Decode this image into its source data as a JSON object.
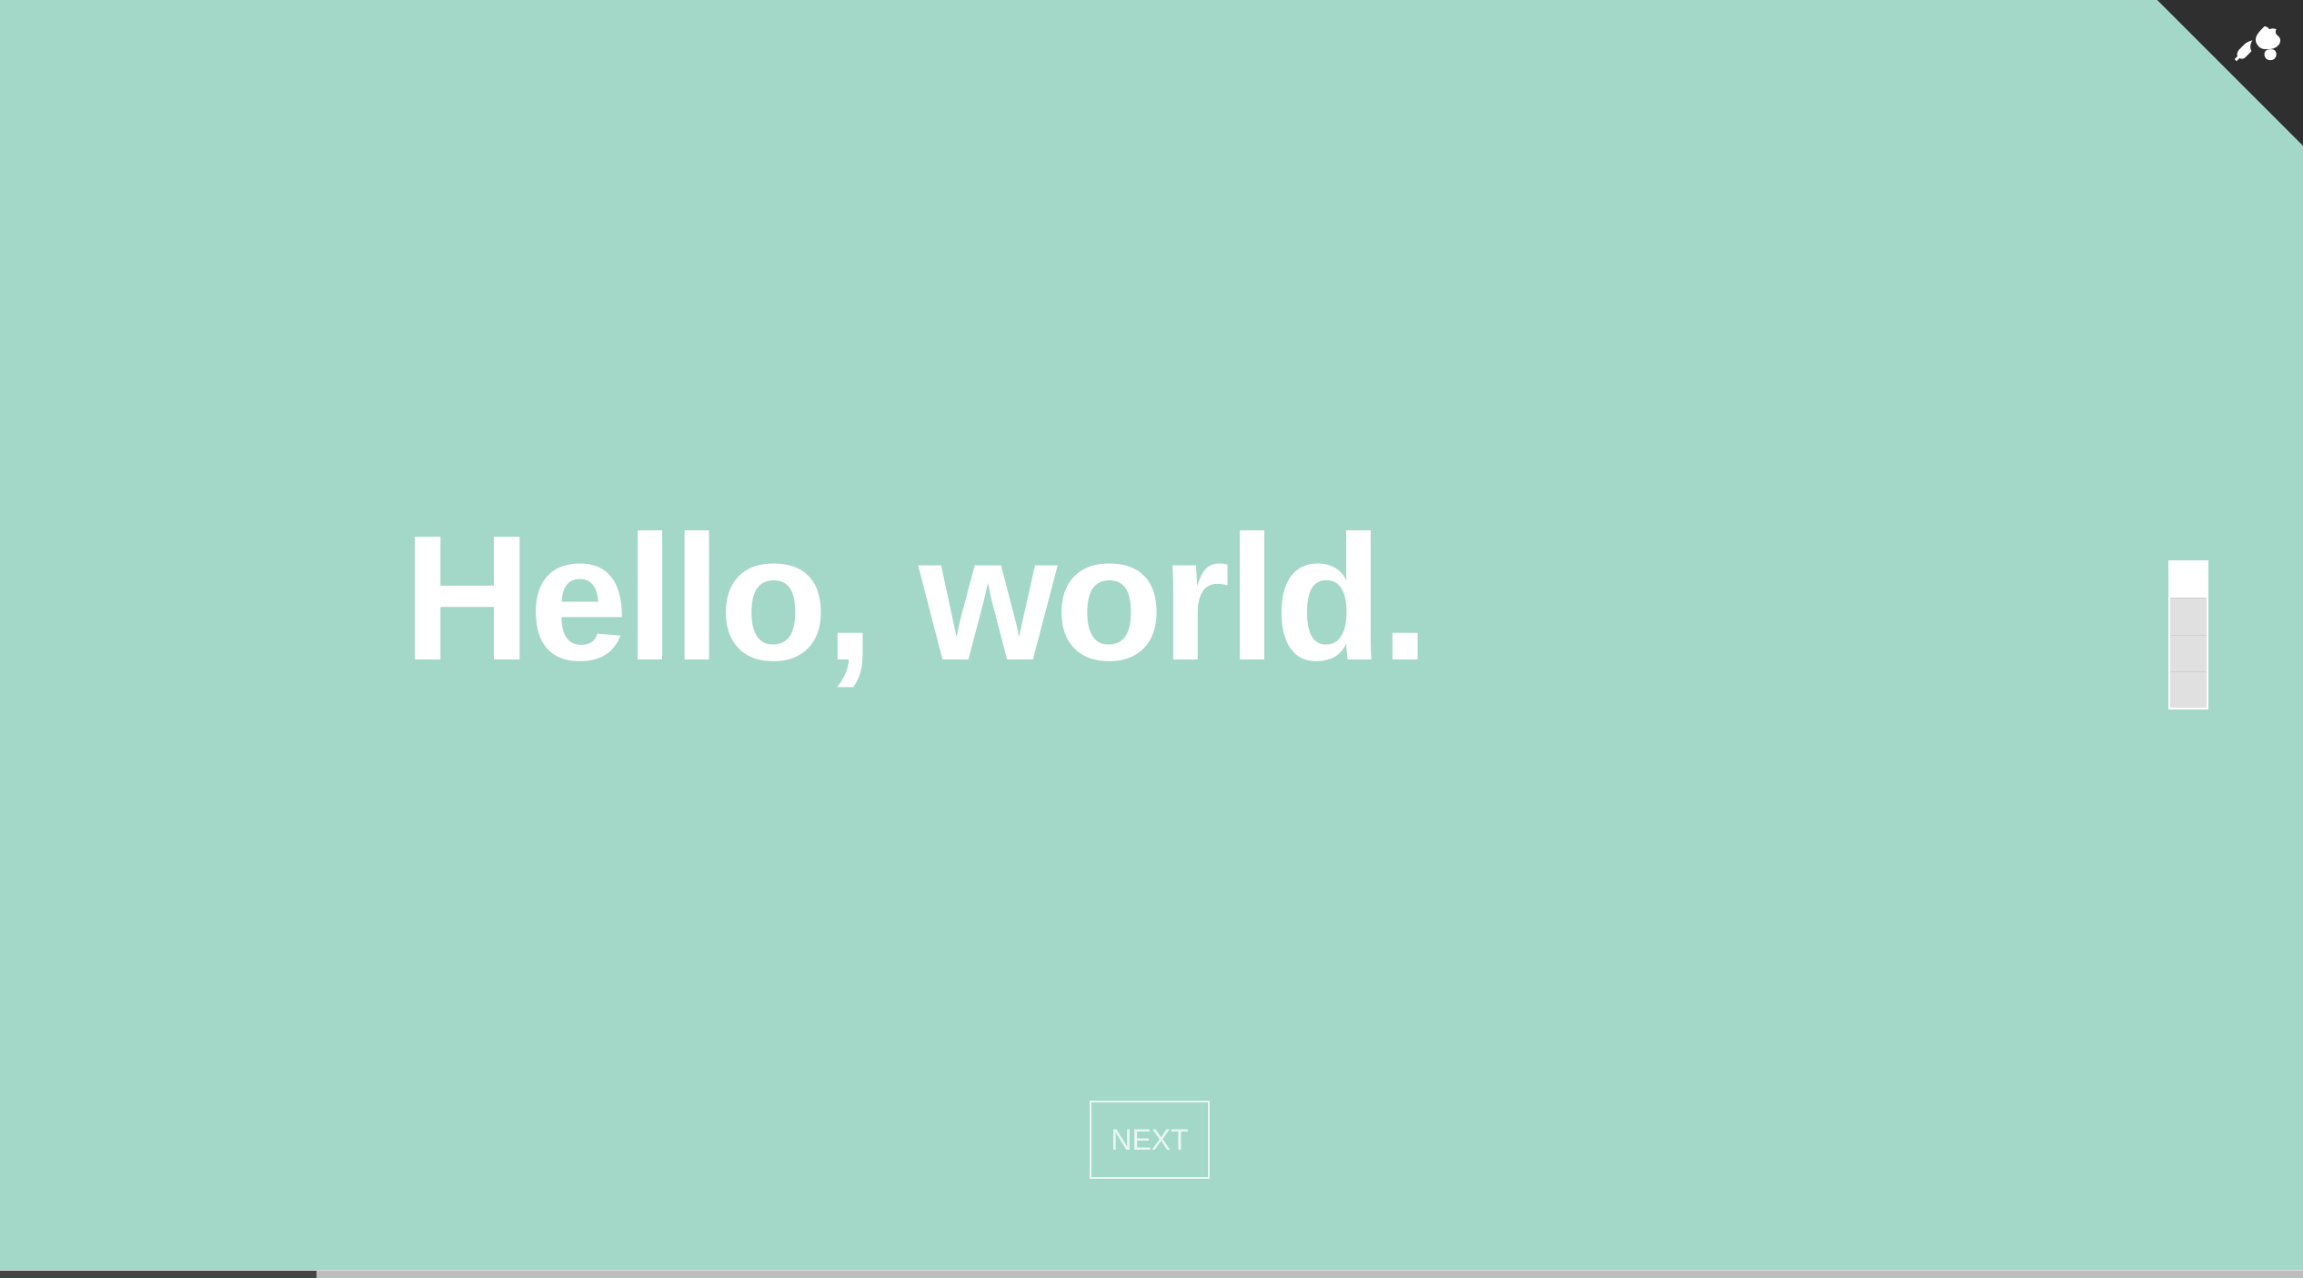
{
  "colors": {
    "background": "#a3d8c8",
    "text": "#ffffff",
    "button_outline": "#e8f6f1",
    "corner": "#2f2f2f"
  },
  "hero": {
    "text": "Hello, world."
  },
  "next_button": {
    "label": "NEXT"
  },
  "pager": {
    "segments": 4,
    "active_index": 0
  },
  "icons": {
    "corner_icon": "octocat-icon"
  }
}
